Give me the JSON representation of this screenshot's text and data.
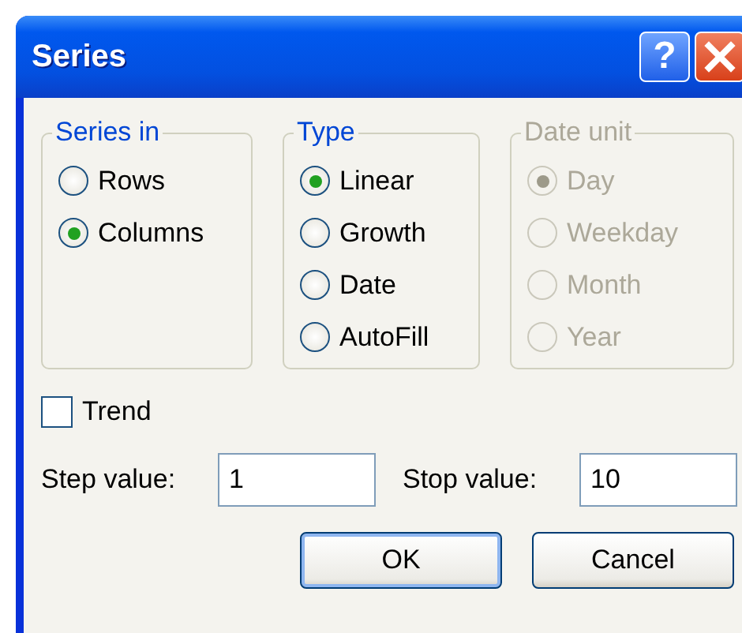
{
  "window": {
    "title": "Series",
    "help_button": "?"
  },
  "groups": [
    {
      "title": "Series in",
      "disabled": false,
      "options": [
        {
          "label": "Rows",
          "selected": false
        },
        {
          "label": "Columns",
          "selected": true
        }
      ]
    },
    {
      "title": "Type",
      "disabled": false,
      "options": [
        {
          "label": "Linear",
          "selected": true
        },
        {
          "label": "Growth",
          "selected": false
        },
        {
          "label": "Date",
          "selected": false
        },
        {
          "label": "AutoFill",
          "selected": false
        }
      ]
    },
    {
      "title": "Date unit",
      "disabled": true,
      "options": [
        {
          "label": "Day",
          "selected": true
        },
        {
          "label": "Weekday",
          "selected": false
        },
        {
          "label": "Month",
          "selected": false
        },
        {
          "label": "Year",
          "selected": false
        }
      ]
    }
  ],
  "trend": {
    "label": "Trend",
    "checked": false
  },
  "fields": [
    {
      "label": "Step value:",
      "value": "1"
    },
    {
      "label": "Stop value:",
      "value": "10"
    }
  ],
  "buttons": [
    {
      "label": "OK",
      "default": true
    },
    {
      "label": "Cancel",
      "default": false
    }
  ]
}
